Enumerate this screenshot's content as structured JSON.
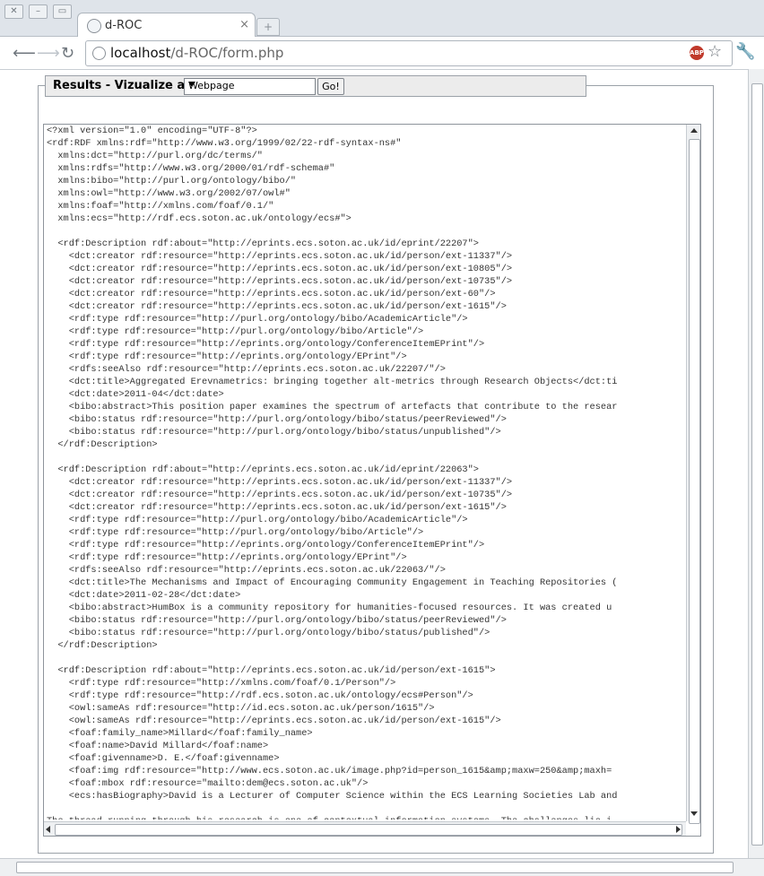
{
  "browser": {
    "tab_title": "d-ROC",
    "url_host": "localhost",
    "url_path": "/d-ROC/form.php",
    "abp_label": "ABP",
    "icons": {
      "back": "back-arrow-icon",
      "forward": "forward-arrow-icon",
      "reload": "reload-icon",
      "star": "bookmark-star-icon",
      "wrench": "wrench-icon"
    }
  },
  "form": {
    "legend_label": "Results - Vizualize as :",
    "select_value": "Webpage",
    "go_label": "Go!"
  },
  "results": {
    "lines": [
      "<?xml version=\"1.0\" encoding=\"UTF-8\"?>",
      "<rdf:RDF xmlns:rdf=\"http://www.w3.org/1999/02/22-rdf-syntax-ns#\"",
      "  xmlns:dct=\"http://purl.org/dc/terms/\"",
      "  xmlns:rdfs=\"http://www.w3.org/2000/01/rdf-schema#\"",
      "  xmlns:bibo=\"http://purl.org/ontology/bibo/\"",
      "  xmlns:owl=\"http://www.w3.org/2002/07/owl#\"",
      "  xmlns:foaf=\"http://xmlns.com/foaf/0.1/\"",
      "  xmlns:ecs=\"http://rdf.ecs.soton.ac.uk/ontology/ecs#\">",
      "",
      "  <rdf:Description rdf:about=\"http://eprints.ecs.soton.ac.uk/id/eprint/22207\">",
      "    <dct:creator rdf:resource=\"http://eprints.ecs.soton.ac.uk/id/person/ext-11337\"/>",
      "    <dct:creator rdf:resource=\"http://eprints.ecs.soton.ac.uk/id/person/ext-10805\"/>",
      "    <dct:creator rdf:resource=\"http://eprints.ecs.soton.ac.uk/id/person/ext-10735\"/>",
      "    <dct:creator rdf:resource=\"http://eprints.ecs.soton.ac.uk/id/person/ext-60\"/>",
      "    <dct:creator rdf:resource=\"http://eprints.ecs.soton.ac.uk/id/person/ext-1615\"/>",
      "    <rdf:type rdf:resource=\"http://purl.org/ontology/bibo/AcademicArticle\"/>",
      "    <rdf:type rdf:resource=\"http://purl.org/ontology/bibo/Article\"/>",
      "    <rdf:type rdf:resource=\"http://eprints.org/ontology/ConferenceItemEPrint\"/>",
      "    <rdf:type rdf:resource=\"http://eprints.org/ontology/EPrint\"/>",
      "    <rdfs:seeAlso rdf:resource=\"http://eprints.ecs.soton.ac.uk/22207/\"/>",
      "    <dct:title>Aggregated Erevnametrics: bringing together alt-metrics through Research Objects</dct:ti",
      "    <dct:date>2011-04</dct:date>",
      "    <bibo:abstract>This position paper examines the spectrum of artefacts that contribute to the resear",
      "    <bibo:status rdf:resource=\"http://purl.org/ontology/bibo/status/peerReviewed\"/>",
      "    <bibo:status rdf:resource=\"http://purl.org/ontology/bibo/status/unpublished\"/>",
      "  </rdf:Description>",
      "",
      "  <rdf:Description rdf:about=\"http://eprints.ecs.soton.ac.uk/id/eprint/22063\">",
      "    <dct:creator rdf:resource=\"http://eprints.ecs.soton.ac.uk/id/person/ext-11337\"/>",
      "    <dct:creator rdf:resource=\"http://eprints.ecs.soton.ac.uk/id/person/ext-10735\"/>",
      "    <dct:creator rdf:resource=\"http://eprints.ecs.soton.ac.uk/id/person/ext-1615\"/>",
      "    <rdf:type rdf:resource=\"http://purl.org/ontology/bibo/AcademicArticle\"/>",
      "    <rdf:type rdf:resource=\"http://purl.org/ontology/bibo/Article\"/>",
      "    <rdf:type rdf:resource=\"http://eprints.org/ontology/ConferenceItemEPrint\"/>",
      "    <rdf:type rdf:resource=\"http://eprints.org/ontology/EPrint\"/>",
      "    <rdfs:seeAlso rdf:resource=\"http://eprints.ecs.soton.ac.uk/22063/\"/>",
      "    <dct:title>The Mechanisms and Impact of Encouraging Community Engagement in Teaching Repositories (",
      "    <dct:date>2011-02-28</dct:date>",
      "    <bibo:abstract>HumBox is a community repository for humanities-focused resources. It was created u",
      "    <bibo:status rdf:resource=\"http://purl.org/ontology/bibo/status/peerReviewed\"/>",
      "    <bibo:status rdf:resource=\"http://purl.org/ontology/bibo/status/published\"/>",
      "  </rdf:Description>",
      "",
      "  <rdf:Description rdf:about=\"http://eprints.ecs.soton.ac.uk/id/person/ext-1615\">",
      "    <rdf:type rdf:resource=\"http://xmlns.com/foaf/0.1/Person\"/>",
      "    <rdf:type rdf:resource=\"http://rdf.ecs.soton.ac.uk/ontology/ecs#Person\"/>",
      "    <owl:sameAs rdf:resource=\"http://id.ecs.soton.ac.uk/person/1615\"/>",
      "    <owl:sameAs rdf:resource=\"http://eprints.ecs.soton.ac.uk/id/person/ext-1615\"/>",
      "    <foaf:family_name>Millard</foaf:family_name>",
      "    <foaf:name>David Millard</foaf:name>",
      "    <foaf:givenname>D. E.</foaf:givenname>",
      "    <foaf:img rdf:resource=\"http://www.ecs.soton.ac.uk/image.php?id=person_1615&amp;maxw=250&amp;maxh=",
      "    <foaf:mbox rdf:resource=\"mailto:dem@ecs.soton.ac.uk\"/>",
      "    <ecs:hasBiography>David is a Lecturer of Computer Science within the ECS Learning Societies Lab and",
      "",
      "The thread running through his research is one of contextual information systems. The challenges lie i"
    ]
  }
}
